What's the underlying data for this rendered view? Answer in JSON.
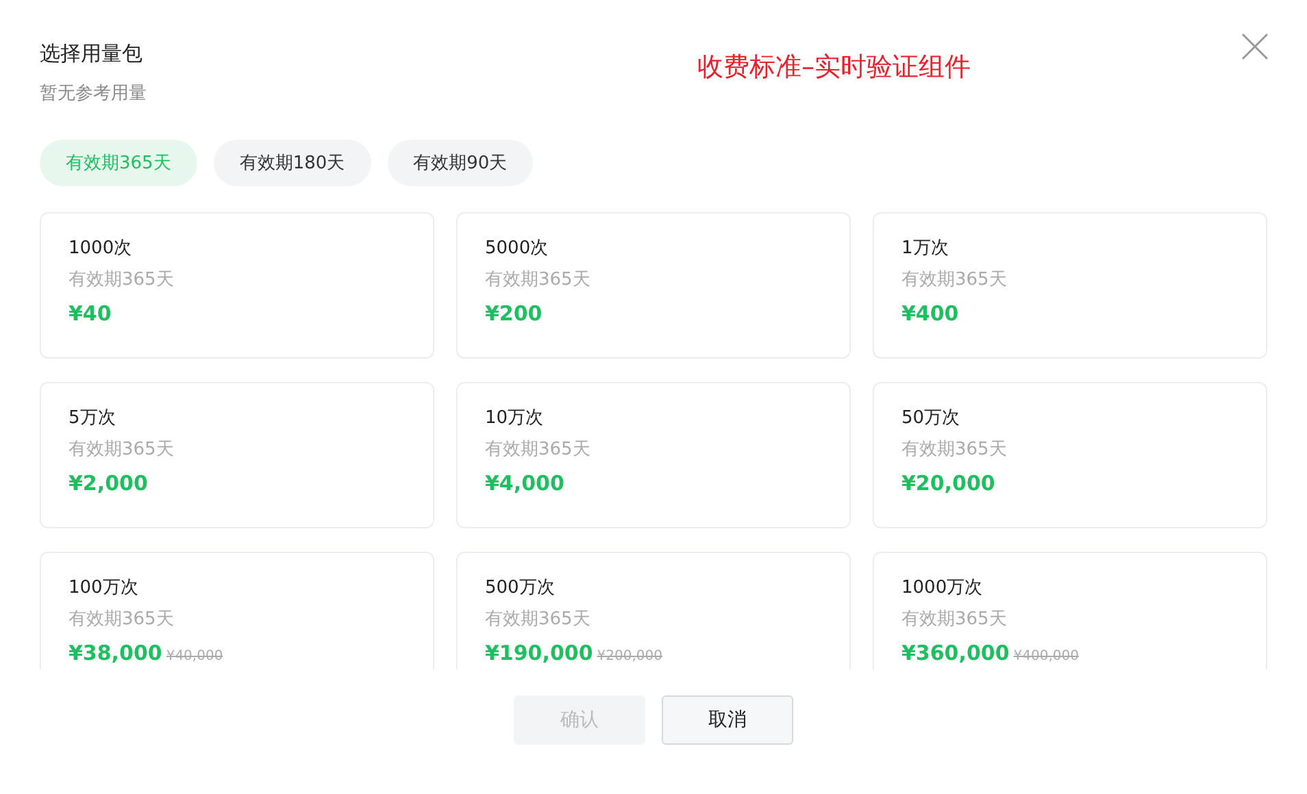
{
  "dialog": {
    "title": "选择用量包",
    "subtitle": "暂无参考用量",
    "annotation": "收费标准–实时验证组件"
  },
  "tabs": [
    {
      "label": "有效期365天",
      "selected": true
    },
    {
      "label": "有效期180天",
      "selected": false
    },
    {
      "label": "有效期90天",
      "selected": false
    }
  ],
  "packages": [
    {
      "name": "1000次",
      "validity": "有效期365天",
      "price": "¥40"
    },
    {
      "name": "5000次",
      "validity": "有效期365天",
      "price": "¥200"
    },
    {
      "name": "1万次",
      "validity": "有效期365天",
      "price": "¥400"
    },
    {
      "name": "5万次",
      "validity": "有效期365天",
      "price": "¥2,000"
    },
    {
      "name": "10万次",
      "validity": "有效期365天",
      "price": "¥4,000"
    },
    {
      "name": "50万次",
      "validity": "有效期365天",
      "price": "¥20,000"
    },
    {
      "name": "100万次",
      "validity": "有效期365天",
      "price": "¥38,000",
      "original_price": "¥40,000"
    },
    {
      "name": "500万次",
      "validity": "有效期365天",
      "price": "¥190,000",
      "original_price": "¥200,000"
    },
    {
      "name": "1000万次",
      "validity": "有效期365天",
      "price": "¥360,000",
      "original_price": "¥400,000"
    }
  ],
  "buttons": [
    {
      "label": "确认",
      "disabled": true
    },
    {
      "label": "取消",
      "disabled": false
    }
  ]
}
